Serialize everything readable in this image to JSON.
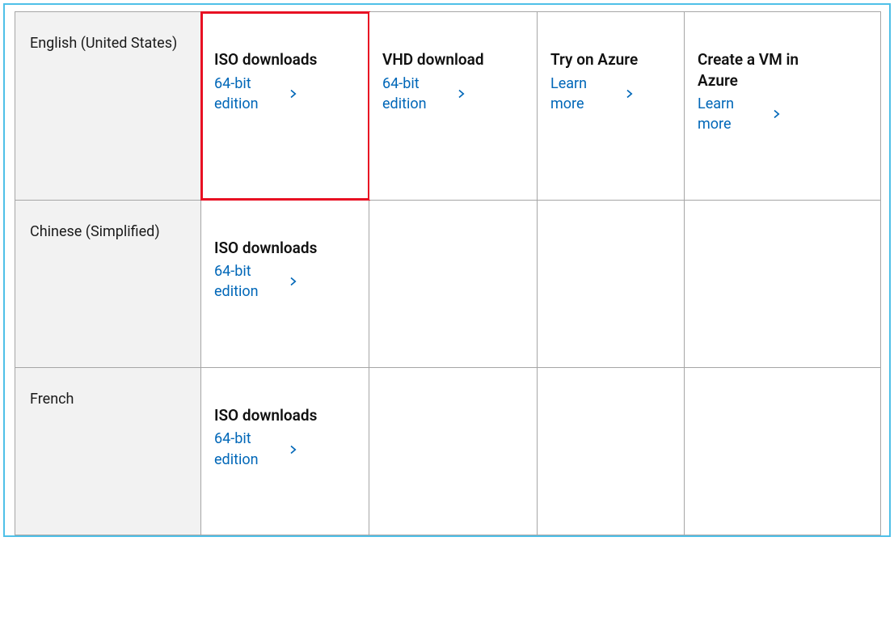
{
  "colors": {
    "accent": "#4fc0e8",
    "link": "#0067b8",
    "highlight": "#e81123"
  },
  "columns": {
    "iso": {
      "title": "ISO downloads"
    },
    "vhd": {
      "title": "VHD download"
    },
    "try": {
      "title": "Try on Azure"
    },
    "vm": {
      "title": "Create a VM in Azure"
    }
  },
  "link_labels": {
    "edition64": "64-bit edition",
    "learn_more": "Learn more"
  },
  "rows": [
    {
      "language": "English (United States)",
      "cells": {
        "iso": {
          "title_key": "iso",
          "link_key": "edition64",
          "highlight": true
        },
        "vhd": {
          "title_key": "vhd",
          "link_key": "edition64"
        },
        "try": {
          "title_key": "try",
          "link_key": "learn_more"
        },
        "vm": {
          "title_key": "vm",
          "link_key": "learn_more"
        }
      }
    },
    {
      "language": "Chinese (Simplified)",
      "cells": {
        "iso": {
          "title_key": "iso",
          "link_key": "edition64"
        },
        "vhd": null,
        "try": null,
        "vm": null
      }
    },
    {
      "language": "French",
      "cells": {
        "iso": {
          "title_key": "iso",
          "link_key": "edition64"
        },
        "vhd": null,
        "try": null,
        "vm": null
      }
    }
  ]
}
